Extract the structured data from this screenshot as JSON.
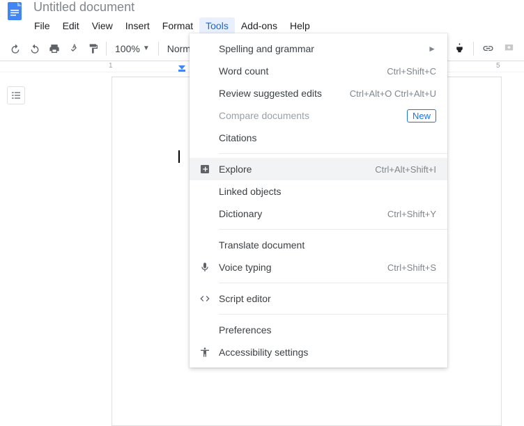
{
  "docTitle": "Untitled document",
  "menuBar": [
    "File",
    "Edit",
    "View",
    "Insert",
    "Format",
    "Tools",
    "Add-ons",
    "Help"
  ],
  "activeMenuIndex": 5,
  "toolbar": {
    "zoom": "100%",
    "style": "Normal"
  },
  "ruler": {
    "visible_numbers": [
      "1",
      "5"
    ]
  },
  "dropdown": {
    "items": [
      {
        "label": "Spelling and grammar",
        "submenu": true
      },
      {
        "label": "Word count",
        "shortcut": "Ctrl+Shift+C"
      },
      {
        "label": "Review suggested edits",
        "shortcut": "Ctrl+Alt+O Ctrl+Alt+U"
      },
      {
        "label": "Compare documents",
        "disabled": true,
        "badge": "New"
      },
      {
        "label": "Citations"
      },
      {
        "sep": true
      },
      {
        "label": "Explore",
        "shortcut": "Ctrl+Alt+Shift+I",
        "icon": "explore-icon",
        "highlighted": true
      },
      {
        "label": "Linked objects"
      },
      {
        "label": "Dictionary",
        "shortcut": "Ctrl+Shift+Y"
      },
      {
        "sep": true
      },
      {
        "label": "Translate document"
      },
      {
        "label": "Voice typing",
        "shortcut": "Ctrl+Shift+S",
        "icon": "mic-icon"
      },
      {
        "sep": true
      },
      {
        "label": "Script editor",
        "icon": "script-icon"
      },
      {
        "sep": true
      },
      {
        "label": "Preferences"
      },
      {
        "label": "Accessibility settings",
        "icon": "accessibility-icon"
      }
    ]
  }
}
